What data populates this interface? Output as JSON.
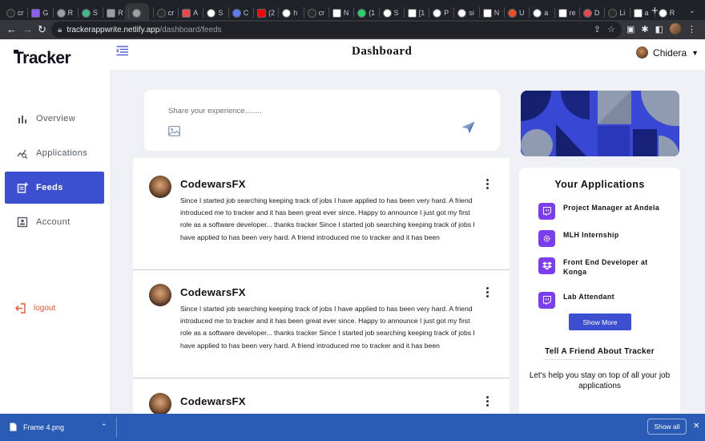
{
  "browser": {
    "tabs": [
      {
        "label": "cr",
        "color": "#2b2b2b"
      },
      {
        "label": "G",
        "color": "#8e5cff"
      },
      {
        "label": "R",
        "color": "#9aa0a6"
      },
      {
        "label": "S",
        "color": "#41b883"
      },
      {
        "label": "R",
        "color": "#9aa0a6"
      },
      {
        "label": "",
        "color": "#9aa0a6"
      },
      {
        "label": "cr",
        "color": "#2b2b2b"
      },
      {
        "label": "A",
        "color": "#e5484d"
      },
      {
        "label": "S",
        "color": "#ffffff"
      },
      {
        "label": "C",
        "color": "#5b7cfa"
      },
      {
        "label": "(2",
        "color": "#ff0000"
      },
      {
        "label": "h",
        "color": "#ffffff"
      },
      {
        "label": "cr",
        "color": "#2b2b2b"
      },
      {
        "label": "N",
        "color": "#ffffff"
      },
      {
        "label": "(1",
        "color": "#25d366"
      },
      {
        "label": "S",
        "color": "#ffffff"
      },
      {
        "label": "[1",
        "color": "#ffffff"
      },
      {
        "label": "P",
        "color": "#ffffff"
      },
      {
        "label": "si",
        "color": "#ffffff"
      },
      {
        "label": "N",
        "color": "#ffffff"
      },
      {
        "label": "U",
        "color": "#f24e1e"
      },
      {
        "label": "a",
        "color": "#ffffff"
      },
      {
        "label": "re",
        "color": "#ffffff"
      },
      {
        "label": "D",
        "color": "#e5484d"
      },
      {
        "label": "Li",
        "color": "#2b2b2b"
      },
      {
        "label": "a",
        "color": "#ffffff"
      },
      {
        "label": "R",
        "color": "#ffffff"
      }
    ],
    "active_tab_index": 5,
    "url_host": "trackerappwrite.netlify.app",
    "url_path": "/dashboard/feeds"
  },
  "app": {
    "logo": "Tracker",
    "page_title": "Dashboard",
    "user_name": "Chidera",
    "nav": [
      {
        "label": "Overview",
        "icon": "bar-chart-icon"
      },
      {
        "label": "Applications",
        "icon": "chart-search-icon"
      },
      {
        "label": "Feeds",
        "icon": "feed-add-icon"
      },
      {
        "label": "Account",
        "icon": "account-icon"
      }
    ],
    "active_nav": "Feeds",
    "logout_label": "logout",
    "share": {
      "placeholder": "Share your experience........"
    },
    "posts": [
      {
        "author": "CodewarsFX",
        "lines": [
          "Since I started job searching keeping track of jobs I have applied to has been very hard. A friend",
          "introduced me to tracker and it has been great ever since. Happy to announce I just got my first",
          "role as a software developer... thanks tracker Since I started job searching keeping track of jobs I",
          "have applied to has been very hard. A friend introduced me to tracker and it has been"
        ]
      },
      {
        "author": "CodewarsFX",
        "lines": [
          "Since I started job searching keeping track of jobs I have applied to has been very hard. A friend",
          "introduced me to tracker and it has been great ever since. Happy to announce I just got my first",
          "role as a software developer... thanks tracker Since I started job searching keeping track of jobs I",
          "have applied to has been very hard. A friend introduced me to tracker and it has been"
        ]
      },
      {
        "author": "CodewarsFX",
        "lines": []
      }
    ],
    "applications": {
      "title": "Your Applications",
      "items": [
        {
          "label": "Project Manager at Andela",
          "icon": "twitch-icon"
        },
        {
          "label": "MLH Internship",
          "icon": "gear-icon"
        },
        {
          "label": "Front End Developer at Konga",
          "icon": "dropbox-icon"
        },
        {
          "label": "Lab Attendant",
          "icon": "twitch-icon"
        }
      ],
      "show_more_label": "Show More",
      "accent": "#7c3cf0"
    },
    "tell_friend": {
      "title": "Tell A Friend About Tracker",
      "body": "Let's help you stay on top of all your job applications"
    },
    "accent_color": "#3d4fd1",
    "logout_color": "#e8542d"
  },
  "downloads": {
    "file_name": "Frame 4.png",
    "show_all_label": "Show all"
  }
}
